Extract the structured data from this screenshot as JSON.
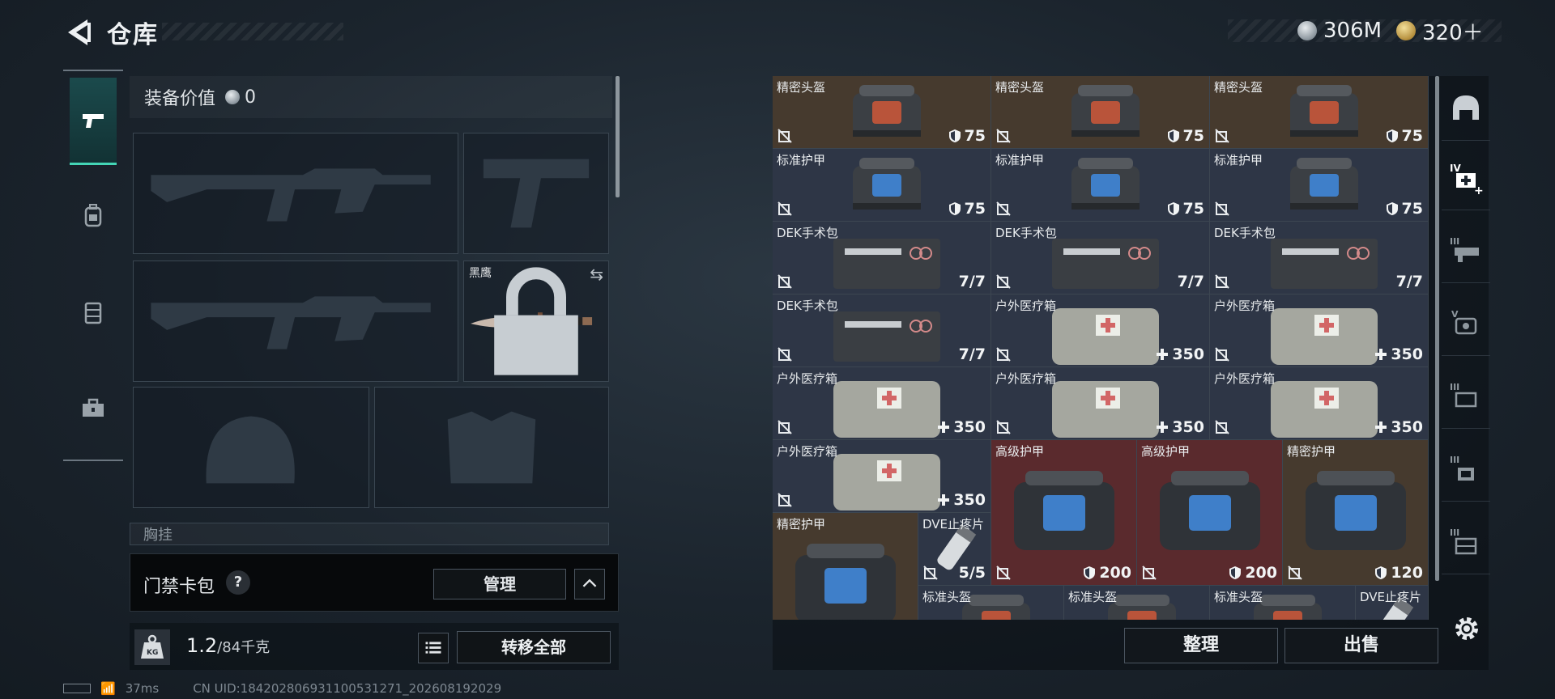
{
  "header": {
    "title": "仓库",
    "currency_a": "306M",
    "currency_b": "320＋"
  },
  "left_nav": [
    "weapon-icon",
    "backpack-icon",
    "vest-icon",
    "toolbox-icon"
  ],
  "equipment": {
    "value_label": "装备价值",
    "value": "0",
    "melee_name": "黑鹰",
    "chest_label": "胸挂",
    "keycard_label": "门禁卡包",
    "help": "?",
    "manage_label": "管理",
    "weight_current": "1.2",
    "weight_max": "/84千克",
    "transfer_all_label": "转移全部"
  },
  "status": {
    "ping": "37ms",
    "uid": "CN UID:184202806931100531271_202608192029"
  },
  "grid": {
    "items": [
      {
        "name": "精密头盔",
        "value": "75",
        "kind": "shield",
        "color": "brown",
        "art": "helmet"
      },
      {
        "name": "精密头盔",
        "value": "75",
        "kind": "shield",
        "color": "brown",
        "art": "helmet"
      },
      {
        "name": "精密头盔",
        "value": "75",
        "kind": "shield",
        "color": "brown",
        "art": "helmet"
      },
      {
        "name": "标准护甲",
        "value": "75",
        "kind": "shield",
        "color": "gray",
        "art": "armor"
      },
      {
        "name": "标准护甲",
        "value": "75",
        "kind": "shield",
        "color": "gray",
        "art": "armor"
      },
      {
        "name": "标准护甲",
        "value": "75",
        "kind": "shield",
        "color": "gray",
        "art": "armor"
      },
      {
        "name": "DEK手术包",
        "value": "7/7",
        "kind": "count",
        "color": "gray",
        "art": "kit"
      },
      {
        "name": "DEK手术包",
        "value": "7/7",
        "kind": "count",
        "color": "gray",
        "art": "kit"
      },
      {
        "name": "DEK手术包",
        "value": "7/7",
        "kind": "count",
        "color": "gray",
        "art": "kit"
      },
      {
        "name": "DEK手术包",
        "value": "7/7",
        "kind": "count",
        "color": "gray",
        "art": "kit"
      },
      {
        "name": "户外医疗箱",
        "value": "350",
        "kind": "heal",
        "color": "gray",
        "art": "medbag"
      },
      {
        "name": "户外医疗箱",
        "value": "350",
        "kind": "heal",
        "color": "gray",
        "art": "medbag"
      },
      {
        "name": "户外医疗箱",
        "value": "350",
        "kind": "heal",
        "color": "gray",
        "art": "medbag"
      },
      {
        "name": "户外医疗箱",
        "value": "350",
        "kind": "heal",
        "color": "gray",
        "art": "medbag"
      },
      {
        "name": "户外医疗箱",
        "value": "350",
        "kind": "heal",
        "color": "gray",
        "art": "medbag"
      },
      {
        "name": "户外医疗箱",
        "value": "350",
        "kind": "heal",
        "color": "gray",
        "art": "medbag"
      },
      {
        "name": "高级护甲",
        "value": "200",
        "kind": "shield",
        "color": "red",
        "art": "armor-big"
      },
      {
        "name": "高级护甲",
        "value": "200",
        "kind": "shield",
        "color": "red",
        "art": "armor-big"
      },
      {
        "name": "精密护甲",
        "value": "120",
        "kind": "shield",
        "color": "brown",
        "art": "armor-big"
      },
      {
        "name": "精密护甲",
        "value": "",
        "kind": "none",
        "color": "brown",
        "art": "armor-big"
      },
      {
        "name": "DVE止疼片",
        "value": "5/5",
        "kind": "count",
        "color": "gray",
        "art": "pill"
      },
      {
        "name": "标准头盔",
        "value": "",
        "kind": "none",
        "color": "gray",
        "art": "helmet"
      },
      {
        "name": "标准头盔",
        "value": "",
        "kind": "none",
        "color": "gray",
        "art": "helmet"
      },
      {
        "name": "标准头盔",
        "value": "",
        "kind": "none",
        "color": "gray",
        "art": "helmet"
      },
      {
        "name": "DVE止疼片",
        "value": "",
        "kind": "none",
        "color": "gray",
        "art": "pill"
      }
    ],
    "sort_label": "整理",
    "sell_label": "出售"
  },
  "right_rail": [
    "helmet-slot-icon",
    "medkit-IV-icon",
    "ammo-III-icon",
    "armor-V-icon",
    "armor-III-icon",
    "armor-III-b-icon",
    "armor-III-c-icon",
    "settings-icon"
  ]
}
